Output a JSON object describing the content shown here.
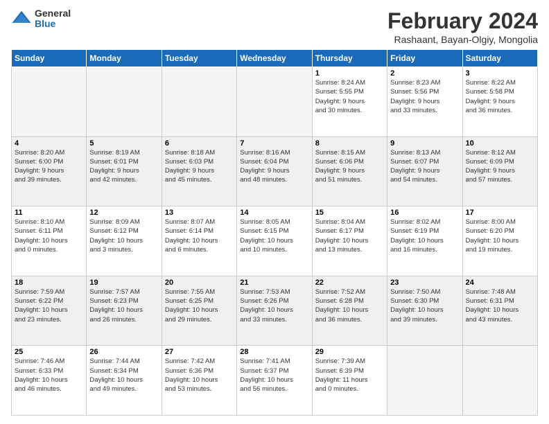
{
  "logo": {
    "general": "General",
    "blue": "Blue"
  },
  "title": "February 2024",
  "location": "Rashaant, Bayan-Olgiy, Mongolia",
  "days_header": [
    "Sunday",
    "Monday",
    "Tuesday",
    "Wednesday",
    "Thursday",
    "Friday",
    "Saturday"
  ],
  "weeks": [
    [
      {
        "day": "",
        "info": ""
      },
      {
        "day": "",
        "info": ""
      },
      {
        "day": "",
        "info": ""
      },
      {
        "day": "",
        "info": ""
      },
      {
        "day": "1",
        "info": "Sunrise: 8:24 AM\nSunset: 5:55 PM\nDaylight: 9 hours\nand 30 minutes."
      },
      {
        "day": "2",
        "info": "Sunrise: 8:23 AM\nSunset: 5:56 PM\nDaylight: 9 hours\nand 33 minutes."
      },
      {
        "day": "3",
        "info": "Sunrise: 8:22 AM\nSunset: 5:58 PM\nDaylight: 9 hours\nand 36 minutes."
      }
    ],
    [
      {
        "day": "4",
        "info": "Sunrise: 8:20 AM\nSunset: 6:00 PM\nDaylight: 9 hours\nand 39 minutes."
      },
      {
        "day": "5",
        "info": "Sunrise: 8:19 AM\nSunset: 6:01 PM\nDaylight: 9 hours\nand 42 minutes."
      },
      {
        "day": "6",
        "info": "Sunrise: 8:18 AM\nSunset: 6:03 PM\nDaylight: 9 hours\nand 45 minutes."
      },
      {
        "day": "7",
        "info": "Sunrise: 8:16 AM\nSunset: 6:04 PM\nDaylight: 9 hours\nand 48 minutes."
      },
      {
        "day": "8",
        "info": "Sunrise: 8:15 AM\nSunset: 6:06 PM\nDaylight: 9 hours\nand 51 minutes."
      },
      {
        "day": "9",
        "info": "Sunrise: 8:13 AM\nSunset: 6:07 PM\nDaylight: 9 hours\nand 54 minutes."
      },
      {
        "day": "10",
        "info": "Sunrise: 8:12 AM\nSunset: 6:09 PM\nDaylight: 9 hours\nand 57 minutes."
      }
    ],
    [
      {
        "day": "11",
        "info": "Sunrise: 8:10 AM\nSunset: 6:11 PM\nDaylight: 10 hours\nand 0 minutes."
      },
      {
        "day": "12",
        "info": "Sunrise: 8:09 AM\nSunset: 6:12 PM\nDaylight: 10 hours\nand 3 minutes."
      },
      {
        "day": "13",
        "info": "Sunrise: 8:07 AM\nSunset: 6:14 PM\nDaylight: 10 hours\nand 6 minutes."
      },
      {
        "day": "14",
        "info": "Sunrise: 8:05 AM\nSunset: 6:15 PM\nDaylight: 10 hours\nand 10 minutes."
      },
      {
        "day": "15",
        "info": "Sunrise: 8:04 AM\nSunset: 6:17 PM\nDaylight: 10 hours\nand 13 minutes."
      },
      {
        "day": "16",
        "info": "Sunrise: 8:02 AM\nSunset: 6:19 PM\nDaylight: 10 hours\nand 16 minutes."
      },
      {
        "day": "17",
        "info": "Sunrise: 8:00 AM\nSunset: 6:20 PM\nDaylight: 10 hours\nand 19 minutes."
      }
    ],
    [
      {
        "day": "18",
        "info": "Sunrise: 7:59 AM\nSunset: 6:22 PM\nDaylight: 10 hours\nand 23 minutes."
      },
      {
        "day": "19",
        "info": "Sunrise: 7:57 AM\nSunset: 6:23 PM\nDaylight: 10 hours\nand 26 minutes."
      },
      {
        "day": "20",
        "info": "Sunrise: 7:55 AM\nSunset: 6:25 PM\nDaylight: 10 hours\nand 29 minutes."
      },
      {
        "day": "21",
        "info": "Sunrise: 7:53 AM\nSunset: 6:26 PM\nDaylight: 10 hours\nand 33 minutes."
      },
      {
        "day": "22",
        "info": "Sunrise: 7:52 AM\nSunset: 6:28 PM\nDaylight: 10 hours\nand 36 minutes."
      },
      {
        "day": "23",
        "info": "Sunrise: 7:50 AM\nSunset: 6:30 PM\nDaylight: 10 hours\nand 39 minutes."
      },
      {
        "day": "24",
        "info": "Sunrise: 7:48 AM\nSunset: 6:31 PM\nDaylight: 10 hours\nand 43 minutes."
      }
    ],
    [
      {
        "day": "25",
        "info": "Sunrise: 7:46 AM\nSunset: 6:33 PM\nDaylight: 10 hours\nand 46 minutes."
      },
      {
        "day": "26",
        "info": "Sunrise: 7:44 AM\nSunset: 6:34 PM\nDaylight: 10 hours\nand 49 minutes."
      },
      {
        "day": "27",
        "info": "Sunrise: 7:42 AM\nSunset: 6:36 PM\nDaylight: 10 hours\nand 53 minutes."
      },
      {
        "day": "28",
        "info": "Sunrise: 7:41 AM\nSunset: 6:37 PM\nDaylight: 10 hours\nand 56 minutes."
      },
      {
        "day": "29",
        "info": "Sunrise: 7:39 AM\nSunset: 6:39 PM\nDaylight: 11 hours\nand 0 minutes."
      },
      {
        "day": "",
        "info": ""
      },
      {
        "day": "",
        "info": ""
      }
    ]
  ]
}
